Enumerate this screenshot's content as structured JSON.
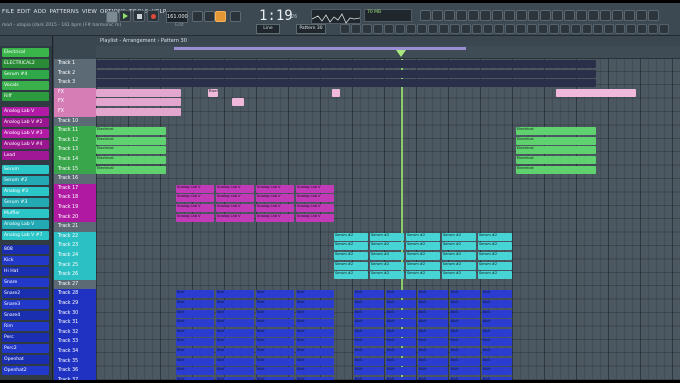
{
  "menu": [
    "FILE",
    "EDIT",
    "ADD",
    "PATTERNS",
    "VIEW",
    "OPTIONS",
    "TOOLS",
    "HELP"
  ],
  "song_title": "mod - utopia (dark 2015 - 161 bpm (F# harmonic m)",
  "tempo": "161.000",
  "time_display": "1:19",
  "time_sub": "26",
  "cpu_text": "70 MB",
  "hint_text": "Edit",
  "mode_select": "Line",
  "pattern_select": "Pattern 30",
  "playlist_title": "Playlist - Arrangement › Pattern 30",
  "channels": [
    {
      "label": "Electrical",
      "color": "#39b54a"
    },
    {
      "label": "ELECTRICAL2",
      "color": "#2a8b36"
    },
    {
      "label": "Serum #4",
      "color": "#2fa84a"
    },
    {
      "label": "Vocals",
      "color": "#3ab04c"
    },
    {
      "label": "Riff",
      "color": "#2c9b3f"
    },
    {
      "label": "Analog Lab V",
      "color": "#b21aa5"
    },
    {
      "label": "Analog Lab V #2",
      "color": "#9a168f"
    },
    {
      "label": "Analog Lab V #3",
      "color": "#b21aa5"
    },
    {
      "label": "Analog Lab V #4",
      "color": "#9a168f"
    },
    {
      "label": "Lead",
      "color": "#a01896"
    },
    {
      "label": "Serum",
      "color": "#2bc6c8"
    },
    {
      "label": "Serum #2",
      "color": "#22a9b3"
    },
    {
      "label": "Analog #3",
      "color": "#2bc6c8"
    },
    {
      "label": "Serum #3",
      "color": "#22a9b3"
    },
    {
      "label": "Muffler",
      "color": "#2bc6c8"
    },
    {
      "label": "Analog Lab V",
      "color": "#22a9b3"
    },
    {
      "label": "Analog Lab V #7",
      "color": "#2bc6c8"
    },
    {
      "label": "808",
      "color": "#1a2fb0"
    },
    {
      "label": "Kick",
      "color": "#2238c9"
    },
    {
      "label": "Hi Hat",
      "color": "#1a2fb0"
    },
    {
      "label": "Snare",
      "color": "#2238c9"
    },
    {
      "label": "Snare2",
      "color": "#1a2fb0"
    },
    {
      "label": "Snare3",
      "color": "#2238c9"
    },
    {
      "label": "Snare4",
      "color": "#1a2fb0"
    },
    {
      "label": "Rim",
      "color": "#2238c9"
    },
    {
      "label": "Perc",
      "color": "#1a2fb0"
    },
    {
      "label": "Perc2",
      "color": "#2238c9"
    },
    {
      "label": "Openhat",
      "color": "#1a2fb0"
    },
    {
      "label": "Openhat2",
      "color": "#2238c9"
    }
  ],
  "tracks": [
    {
      "label": "Track 1",
      "color": "#5b6a74"
    },
    {
      "label": "Track 2",
      "color": "#5b6a74"
    },
    {
      "label": "Track 3",
      "color": "#5b6a74"
    },
    {
      "label": "FX",
      "color": "#d77db6"
    },
    {
      "label": "FX",
      "color": "#d77db6"
    },
    {
      "label": "FX",
      "color": "#d77db6"
    },
    {
      "label": "Track 10",
      "color": "#5b6a74"
    },
    {
      "label": "Track 11",
      "color": "#3aa64c"
    },
    {
      "label": "Track 12",
      "color": "#3aa64c"
    },
    {
      "label": "Track 13",
      "color": "#3aa64c"
    },
    {
      "label": "Track 14",
      "color": "#3aa64c"
    },
    {
      "label": "Track 15",
      "color": "#3aa64c"
    },
    {
      "label": "Track 16",
      "color": "#5b6a74"
    },
    {
      "label": "Track 17",
      "color": "#b01aa3"
    },
    {
      "label": "Track 18",
      "color": "#b01aa3"
    },
    {
      "label": "Track 19",
      "color": "#b01aa3"
    },
    {
      "label": "Track 20",
      "color": "#b01aa3"
    },
    {
      "label": "Track 21",
      "color": "#5b6a74"
    },
    {
      "label": "Track 22",
      "color": "#2bc0c3"
    },
    {
      "label": "Track 23",
      "color": "#2bc0c3"
    },
    {
      "label": "Track 24",
      "color": "#2bc0c3"
    },
    {
      "label": "Track 25",
      "color": "#2bc0c3"
    },
    {
      "label": "Track 26",
      "color": "#2bc0c3"
    },
    {
      "label": "Track 27",
      "color": "#5b6a74"
    },
    {
      "label": "Track 28",
      "color": "#1f32c2"
    },
    {
      "label": "Track 29",
      "color": "#1f32c2"
    },
    {
      "label": "Track 30",
      "color": "#1f32c2"
    },
    {
      "label": "Track 31",
      "color": "#1f32c2"
    },
    {
      "label": "Track 32",
      "color": "#1f32c2"
    },
    {
      "label": "Track 33",
      "color": "#1f32c2"
    },
    {
      "label": "Track 34",
      "color": "#1f32c2"
    },
    {
      "label": "Track 35",
      "color": "#1f32c2"
    },
    {
      "label": "Track 36",
      "color": "#1f32c2"
    },
    {
      "label": "Track 37",
      "color": "#1f32c2"
    }
  ],
  "clip_labels": {
    "green": "Electrical",
    "pink": "Riser FX",
    "magenta": "Analog Lab V",
    "cyan": "Serum #2",
    "blue": "Kick"
  }
}
